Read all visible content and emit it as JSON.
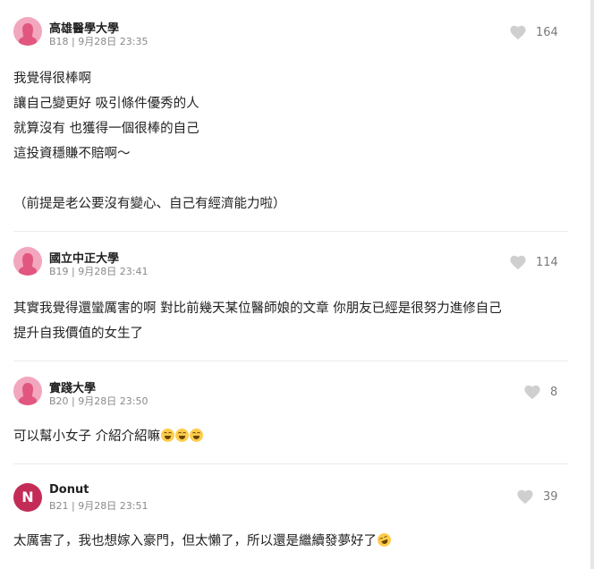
{
  "comments": [
    {
      "school": "高雄醫學大學",
      "floor": "B18",
      "time": "9月28日 23:35",
      "likes": "164",
      "avatar": "female-avatar",
      "lines": [
        "我覺得很棒啊",
        "讓自己變更好 吸引條件優秀的人",
        "就算沒有 也獲得一個很棒的自己",
        "這投資穩賺不賠啊～",
        "",
        "（前提是老公要沒有變心、自己有經濟能力啦）"
      ]
    },
    {
      "school": "國立中正大學",
      "floor": "B19",
      "time": "9月28日 23:41",
      "likes": "114",
      "avatar": "female-avatar",
      "lines": [
        "其實我覺得還蠻厲害的啊 對比前幾天某位醫師娘的文章 你朋友已經是很努力進修自己",
        "提升自我價值的女生了"
      ]
    },
    {
      "school": "實踐大學",
      "floor": "B20",
      "time": "9月28日 23:50",
      "likes": "8",
      "avatar": "female-avatar",
      "lines": [
        "可以幫小女子 介紹介紹嘛"
      ]
    },
    {
      "school": "Donut",
      "floor": "B21",
      "time": "9月28日 23:51",
      "likes": "39",
      "avatar": "letter-avatar",
      "avatar_letter": "N",
      "lines": [
        "太厲害了，我也想嫁入豪門，但太懶了，所以還是繼續發夢好了"
      ]
    }
  ],
  "separator": " | ",
  "colors": {
    "female_avatar": "#f2a7bf",
    "letter_avatar": "#c42c58",
    "heart": "#cfcfcf"
  },
  "icons": [
    "heart-icon",
    "female-silhouette-icon",
    "laughing-emoji-icon",
    "rofl-emoji-icon"
  ]
}
